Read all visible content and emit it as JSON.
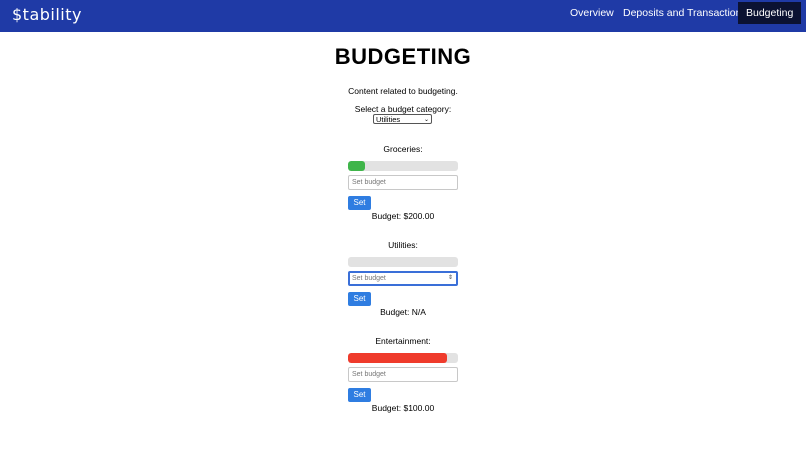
{
  "nav": {
    "logo": "$tability",
    "items": [
      "Overview",
      "Deposits and Transactions",
      "Budgeting"
    ],
    "active": "Budgeting",
    "color": "#1f3aa6",
    "active_color": "#0b1232"
  },
  "page": {
    "title": "BUDGETING",
    "description": "Content related to budgeting.",
    "select_label": "Select a budget category:",
    "selected_category": "Utilities"
  },
  "categories": [
    {
      "label": "Groceries:",
      "progress": 0.15,
      "bar_color": "#3fb54a",
      "input_placeholder": "Set budget",
      "button": "Set",
      "budget": "Budget: $200.00"
    },
    {
      "label": "Utilities:",
      "progress": 0.0,
      "bar_color": "#3fb54a",
      "input_placeholder": "Set budget",
      "button": "Set",
      "budget": "Budget: N/A"
    },
    {
      "label": "Entertainment:",
      "progress": 0.9,
      "bar_color": "#ef3b2c",
      "input_placeholder": "Set budget",
      "button": "Set",
      "budget": "Budget: $100.00"
    }
  ]
}
